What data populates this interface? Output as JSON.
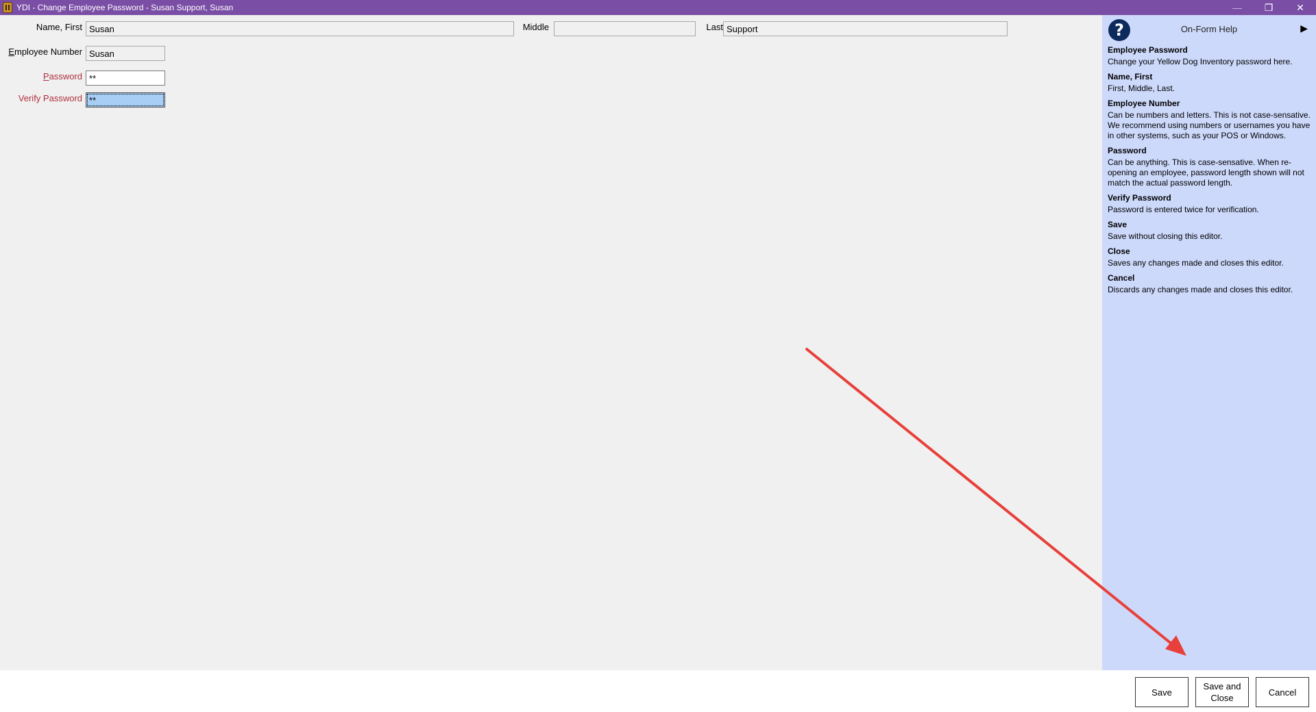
{
  "window": {
    "title": "YDI - Change Employee Password - Susan Support, Susan",
    "minimize_glyph": "—",
    "restore_glyph": "❐",
    "close_glyph": "✕"
  },
  "form": {
    "first_label": "Name, First",
    "first_value": "Susan",
    "middle_label": "Middle",
    "middle_value": "",
    "last_label": "Last",
    "last_value": "Support",
    "empnum_label_pre": "E",
    "empnum_label_rest": "mployee Number",
    "empnum_value": "Susan",
    "password_label_pre": "P",
    "password_label_rest": "assword",
    "password_value": "**",
    "verify_label": "Verify Password",
    "verify_value": "**"
  },
  "help": {
    "title": "On-Form Help",
    "expand_glyph": "▶",
    "question_glyph": "?",
    "items": [
      {
        "heading": "Employee Password",
        "text": "Change your Yellow Dog Inventory password here."
      },
      {
        "heading": "Name, First",
        "text": "First, Middle, Last."
      },
      {
        "heading": "Employee Number",
        "text": "Can be numbers and letters. This is not case-sensative. We recommend using numbers or usernames you have in other systems, such as your POS or Windows."
      },
      {
        "heading": "Password",
        "text": "Can be anything. This is case-sensative. When re-opening an employee, password length shown will not match the actual password length."
      },
      {
        "heading": "Verify Password",
        "text": "Password is entered twice for verification."
      },
      {
        "heading": "Save",
        "text": "Save without closing this editor."
      },
      {
        "heading": "Close",
        "text": "Saves any changes made and closes this editor."
      },
      {
        "heading": "Cancel",
        "text": "Discards any changes made and closes this editor."
      }
    ]
  },
  "footer": {
    "save_label": "Save",
    "save_close_label_1": "Save and",
    "save_close_label_2": "Close",
    "cancel_label": "Cancel"
  },
  "annotation": {
    "arrow_color": "#e8403a"
  }
}
